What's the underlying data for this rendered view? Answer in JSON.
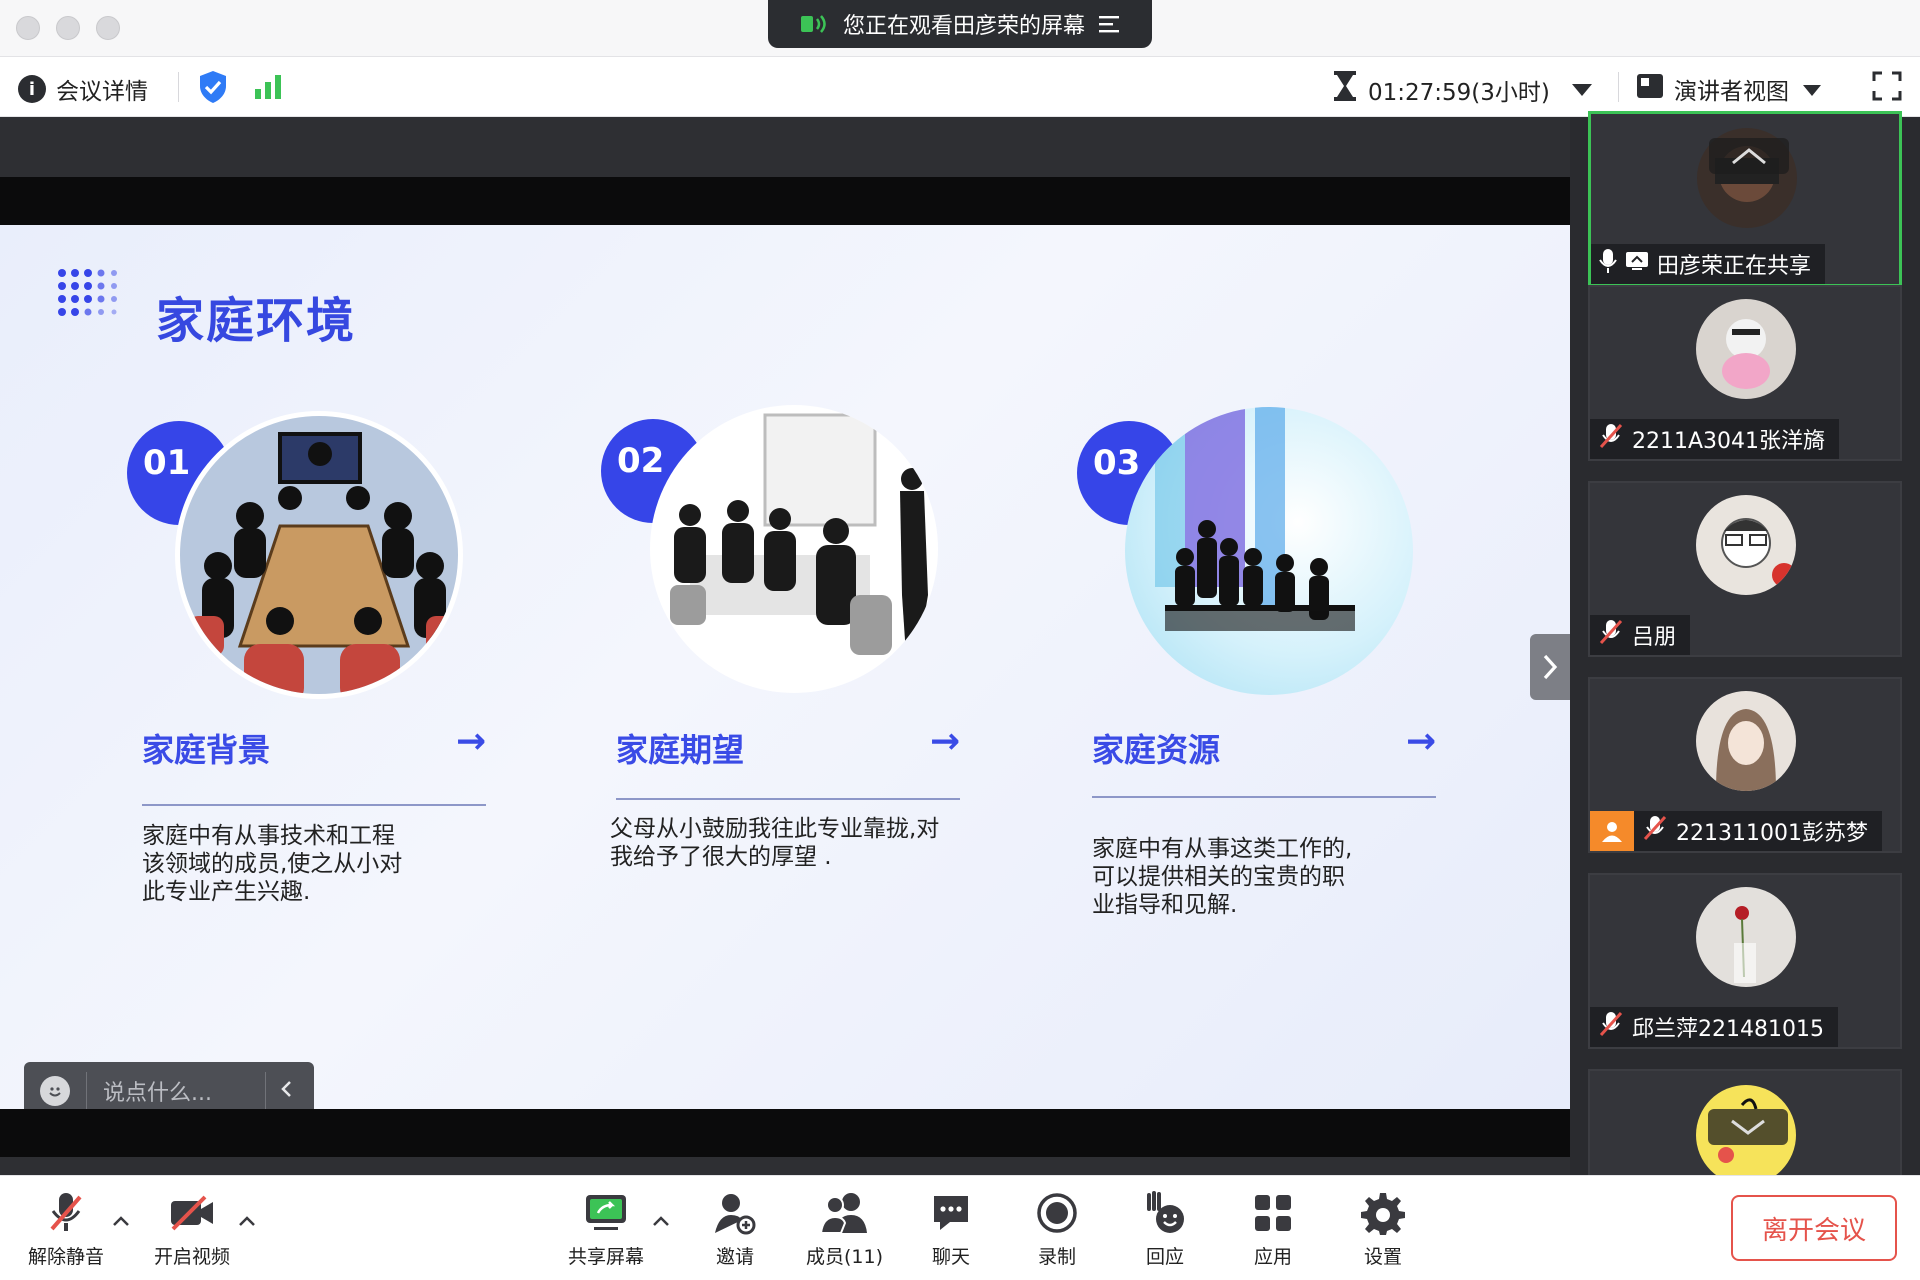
{
  "titlebar": {
    "share_banner": "您正在观看田彦荣的屏幕"
  },
  "infobar": {
    "meeting_details": "会议详情",
    "timer": "01:27:59(3小时)",
    "view_mode": "演讲者视图"
  },
  "slide": {
    "title": "家庭环境",
    "cards": [
      {
        "num": "01",
        "title": "家庭背景",
        "text": [
          "家庭中有从事技术和工程",
          "该领域的成员,使之从小对",
          "此专业产生兴趣."
        ]
      },
      {
        "num": "02",
        "title": "家庭期望",
        "text": [
          "父母从小鼓励我往此专业靠拢,对",
          "我给予了很大的厚望 ."
        ]
      },
      {
        "num": "03",
        "title": "家庭资源",
        "text": [
          "家庭中有从事这类工作的,",
          "可以提供相关的宝贵的职",
          "业指导和见解."
        ]
      }
    ]
  },
  "chat": {
    "placeholder": "说点什么..."
  },
  "participants": [
    {
      "name": "田彦荣正在共享",
      "sharing": true
    },
    {
      "name": "2211A3041张洋旖",
      "muted": true
    },
    {
      "name": "吕朋",
      "muted": true
    },
    {
      "name": "221311001彭苏梦",
      "muted": true
    },
    {
      "name": "邱兰萍221481015",
      "muted": true
    }
  ],
  "toolbar": {
    "unmute": "解除静音",
    "start_video": "开启视频",
    "share_screen": "共享屏幕",
    "invite": "邀请",
    "members": "成员(11)",
    "chat": "聊天",
    "record": "录制",
    "react": "回应",
    "apps": "应用",
    "settings": "设置",
    "leave": "离开会议"
  },
  "colors": {
    "accent_blue": "#3645e8",
    "active_green": "#3cc356",
    "leave_red": "#e5534b"
  }
}
